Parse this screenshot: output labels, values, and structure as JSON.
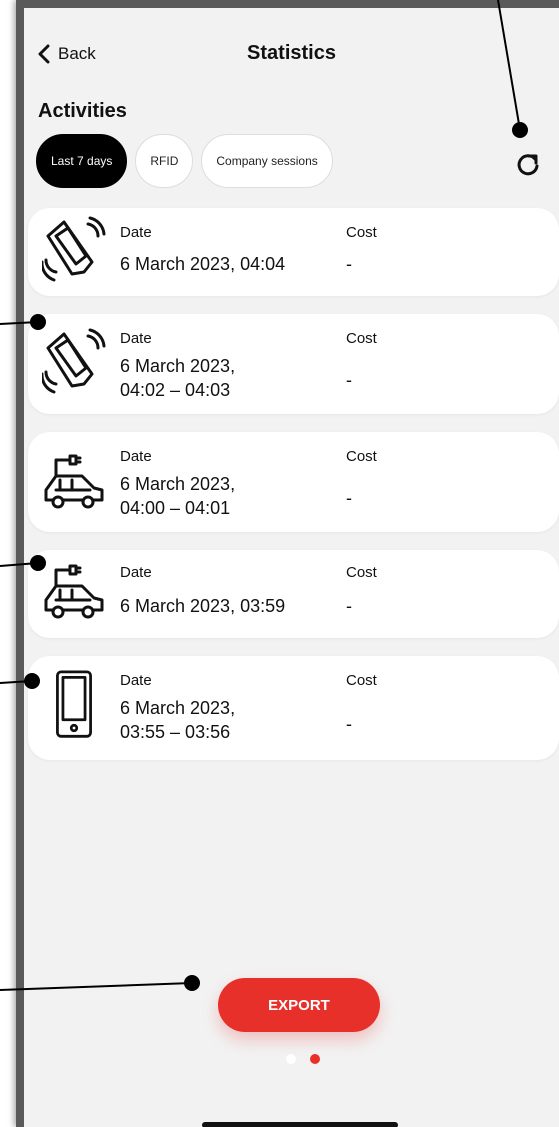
{
  "nav": {
    "back_label": "Back",
    "title": "Statistics"
  },
  "section_title": "Activities",
  "filters": [
    {
      "label": "Last 7 days",
      "active": true
    },
    {
      "label": "RFID",
      "active": false
    },
    {
      "label": "Company sessions",
      "active": false
    }
  ],
  "refresh_icon": "refresh-icon",
  "activities": [
    {
      "icon": "rfid-card-icon",
      "date_label": "Date",
      "date": "6 March 2023, 04:04",
      "cost_label": "Cost",
      "cost": "-"
    },
    {
      "icon": "rfid-card-icon",
      "date_label": "Date",
      "date_line1": "6 March 2023,",
      "date_line2": "04:02 – 04:03",
      "cost_label": "Cost",
      "cost": "-"
    },
    {
      "icon": "car-charging-icon",
      "date_label": "Date",
      "date_line1": "6 March 2023,",
      "date_line2": "04:00 – 04:01",
      "cost_label": "Cost",
      "cost": "-"
    },
    {
      "icon": "car-charging-icon",
      "date_label": "Date",
      "date": "6 March 2023, 03:59",
      "cost_label": "Cost",
      "cost": "-"
    },
    {
      "icon": "mobile-phone-icon",
      "date_label": "Date",
      "date_line1": "6 March 2023,",
      "date_line2": "03:55 – 03:56",
      "cost_label": "Cost",
      "cost": "-"
    }
  ],
  "export_label": "EXPORT",
  "pager": {
    "pages": 2,
    "current": 2
  },
  "colors": {
    "accent": "#e8302a",
    "background": "#f2f2f2",
    "card": "#ffffff",
    "chip_active": "#000000"
  }
}
